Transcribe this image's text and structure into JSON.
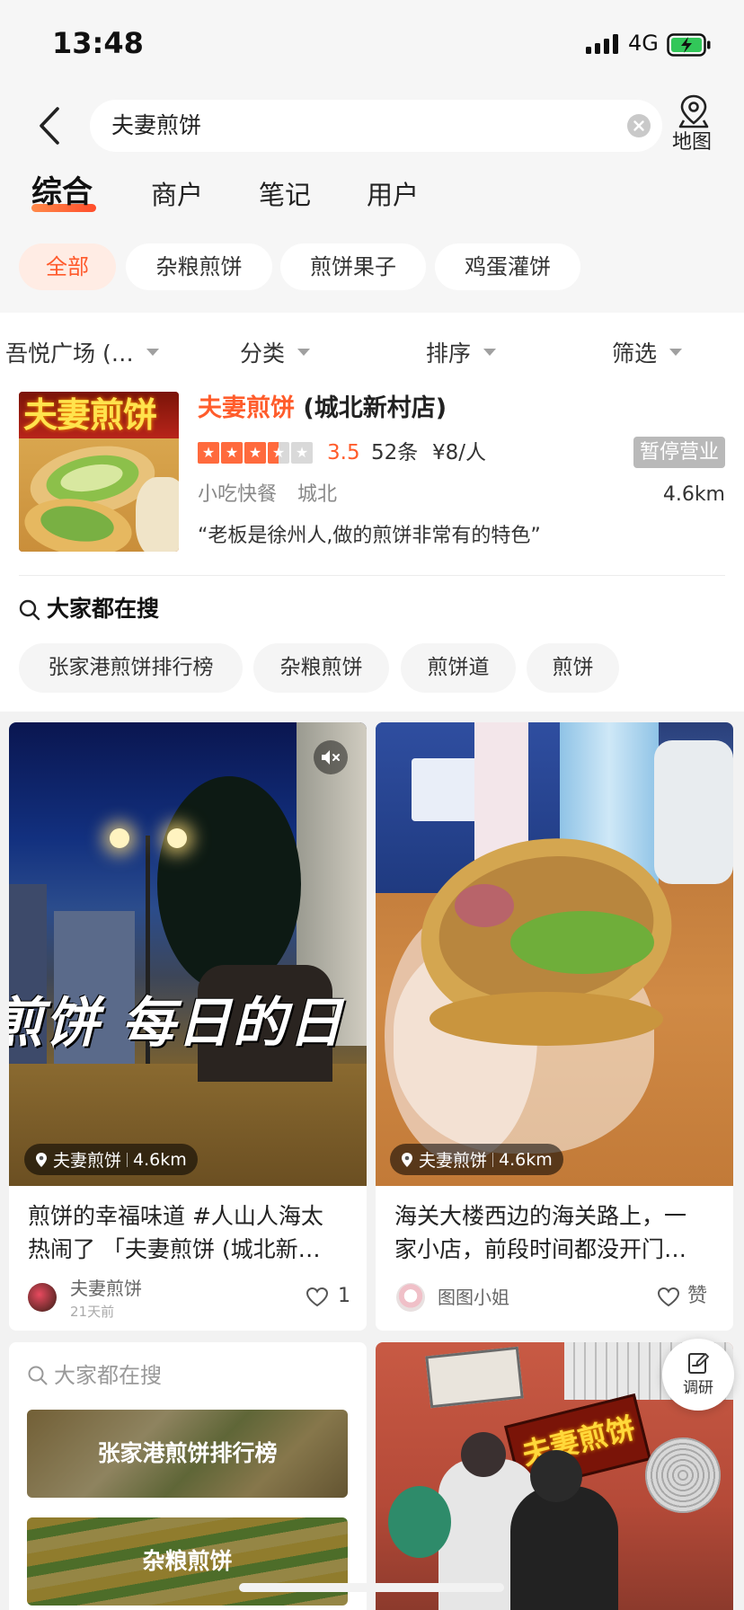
{
  "status_bar": {
    "time": "13:48",
    "network": "4G",
    "battery_charging": true,
    "signal_icon": "signal-bars-icon",
    "battery_icon": "battery-charging-icon"
  },
  "search": {
    "back_icon": "chevron-left-icon",
    "query": "夫妻煎饼",
    "clear_icon": "clear-circle-icon",
    "map_icon": "map-pin-icon",
    "map_label": "地图"
  },
  "tabs": [
    {
      "label": "综合",
      "active": true
    },
    {
      "label": "商户",
      "active": false
    },
    {
      "label": "笔记",
      "active": false
    },
    {
      "label": "用户",
      "active": false
    }
  ],
  "category_chips": [
    {
      "label": "全部",
      "active": true
    },
    {
      "label": "杂粮煎饼",
      "active": false
    },
    {
      "label": "煎饼果子",
      "active": false
    },
    {
      "label": "鸡蛋灌饼",
      "active": false
    }
  ],
  "filters": [
    {
      "label": "吾悦广场 (…"
    },
    {
      "label": "分类"
    },
    {
      "label": "排序"
    },
    {
      "label": "筛选"
    }
  ],
  "merchant": {
    "name_highlight": "夫妻煎饼",
    "name_suffix": " (城北新村店)",
    "rating": 3.5,
    "rating_text": "3.5",
    "reviews": "52条",
    "price": "¥8/人",
    "status": "暂停营业",
    "category": "小吃快餐",
    "area": "城北",
    "distance": "4.6km",
    "quote": "“老板是徐州人,做的煎饼非常有的特色”",
    "photo_sign": "夫妻煎饼"
  },
  "hot_search": {
    "icon": "search-icon",
    "title": "大家都在搜",
    "items": [
      "张家港煎饼排行榜",
      "杂粮煎饼",
      "煎饼道",
      "煎饼"
    ]
  },
  "feed": {
    "notes": [
      {
        "video_caption": "煎饼 每日的日",
        "muted": true,
        "location_name": "夫妻煎饼",
        "location_distance": "4.6km",
        "title_line1": "煎饼的幸福味道 #人山人海太",
        "title_line2": "热闹了 「夫妻煎饼 (城北新…",
        "author": "夫妻煎饼",
        "posted": "21天前",
        "likes": "1"
      },
      {
        "location_name": "夫妻煎饼",
        "location_distance": "4.6km",
        "title_line1": "海关大楼西边的海关路上，一",
        "title_line2": "家小店，前段时间都没开门…",
        "author": "图图小姐",
        "likes": "赞"
      },
      {
        "shop_sign": "夫妻煎饼"
      }
    ],
    "hot_search_card": {
      "title": "大家都在搜",
      "items": [
        "张家港煎饼排行榜",
        "杂粮煎饼"
      ]
    }
  },
  "floating_button": {
    "label": "调研",
    "icon": "edit-note-icon"
  },
  "colors": {
    "accent": "#ff5c2b",
    "star": "#ff6a3d",
    "status_badge": "#b9b9b9",
    "feed_bg": "#f2f2f2",
    "battery": "#32c759"
  }
}
